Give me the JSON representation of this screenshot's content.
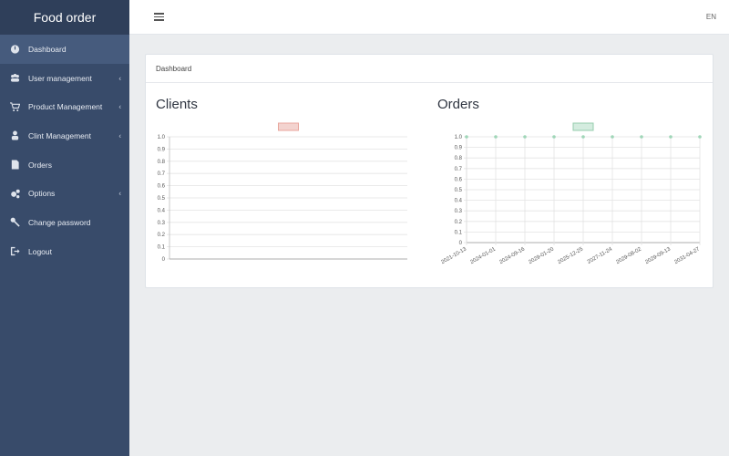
{
  "app": {
    "title": "Food order"
  },
  "sidebar": {
    "items": [
      {
        "label": "Dashboard",
        "icon": "gauge-icon",
        "has_caret": false,
        "active": true
      },
      {
        "label": "User management",
        "icon": "users-icon",
        "has_caret": true,
        "active": false
      },
      {
        "label": "Product Management",
        "icon": "cart-icon",
        "has_caret": true,
        "active": false
      },
      {
        "label": "Clint Management",
        "icon": "user-icon",
        "has_caret": true,
        "active": false
      },
      {
        "label": "Orders",
        "icon": "document-icon",
        "has_caret": false,
        "active": false
      },
      {
        "label": "Options",
        "icon": "gears-icon",
        "has_caret": true,
        "active": false
      },
      {
        "label": "Change password",
        "icon": "key-icon",
        "has_caret": false,
        "active": false
      },
      {
        "label": "Logout",
        "icon": "sign-out-icon",
        "has_caret": false,
        "active": false
      }
    ],
    "caret": "‹"
  },
  "topbar": {
    "language": "EN"
  },
  "breadcrumb": "Dashboard",
  "colors": {
    "sidebar_bg": "#384b6a",
    "brand_bg": "#2f3f5a",
    "active_item_bg": "#465b7d",
    "clients_legend": "#f3d3cf",
    "clients_legend_border": "#e8a59c",
    "orders_legend": "#d4ecdf",
    "orders_legend_border": "#95ccad",
    "orders_point": "#9fd6b8"
  },
  "chart_data": [
    {
      "type": "line",
      "title": "Clients",
      "x": [],
      "series": [
        {
          "values": []
        }
      ],
      "ylim": [
        0,
        1.0
      ],
      "yticks": [
        "0",
        "0.1",
        "0.2",
        "0.3",
        "0.4",
        "0.5",
        "0.6",
        "0.7",
        "0.8",
        "0.9",
        "1.0"
      ],
      "legend": "top-center",
      "grid": true
    },
    {
      "type": "line",
      "title": "Orders",
      "x": [
        "2021-10-13",
        "2024-01-01",
        "2024-09-16",
        "2029-01-20",
        "2025-12-25",
        "2027-11-24",
        "2029-08-02",
        "2029-09-13",
        "2031-04-27"
      ],
      "series": [
        {
          "values": [
            1,
            1,
            1,
            1,
            1,
            1,
            1,
            1,
            1
          ]
        }
      ],
      "ylim": [
        0,
        1.0
      ],
      "yticks": [
        "0",
        "0.1",
        "0.2",
        "0.3",
        "0.4",
        "0.5",
        "0.6",
        "0.7",
        "0.8",
        "0.9",
        "1.0"
      ],
      "legend": "top-center",
      "grid": true
    }
  ]
}
